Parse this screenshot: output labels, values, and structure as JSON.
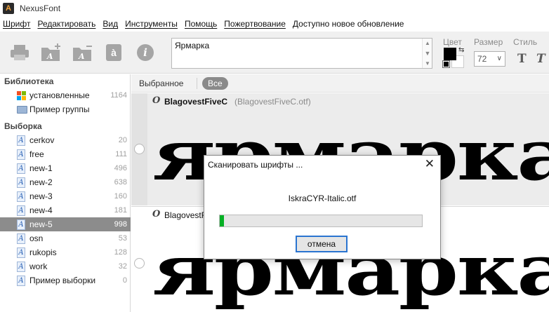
{
  "window": {
    "title": "NexusFont",
    "app_icon_letter": "A"
  },
  "menu": [
    {
      "label": "Шрифт",
      "underlined": true
    },
    {
      "label": "Редактировать",
      "underlined": true
    },
    {
      "label": "Вид",
      "underlined": true
    },
    {
      "label": "Инструменты",
      "underlined": true
    },
    {
      "label": "Помощь",
      "underlined": true
    },
    {
      "label": "Пожертвование",
      "underlined": true
    },
    {
      "label": "Доступно новое обновление",
      "underlined": false
    }
  ],
  "toolbar": {
    "sample_text": "Ярмарка",
    "color_label": "Цвет",
    "size_label": "Размер",
    "size_value": "72",
    "style_label": "Стиль",
    "style_bold_glyph": "T",
    "style_italic_glyph": "T",
    "fg_color": "#000000",
    "bg_color": "#ffffff",
    "icons": [
      "print-icon",
      "add-library-icon",
      "remove-library-icon",
      "character-map-icon",
      "info-icon"
    ]
  },
  "sidebar": {
    "library_title": "Библиотека",
    "library_items": [
      {
        "label": "установленные",
        "count": "1164",
        "icon": "windows-icon"
      },
      {
        "label": "Пример группы",
        "count": "",
        "icon": "folder-icon"
      }
    ],
    "selection_title": "Выборка",
    "selection_items": [
      {
        "label": "cerkov",
        "count": "20",
        "selected": false
      },
      {
        "label": "free",
        "count": "111",
        "selected": false
      },
      {
        "label": "new-1",
        "count": "496",
        "selected": false
      },
      {
        "label": "new-2",
        "count": "638",
        "selected": false
      },
      {
        "label": "new-3",
        "count": "160",
        "selected": false
      },
      {
        "label": "new-4",
        "count": "181",
        "selected": false
      },
      {
        "label": "new-5",
        "count": "998",
        "selected": true
      },
      {
        "label": "osn",
        "count": "53",
        "selected": false
      },
      {
        "label": "rukopis",
        "count": "128",
        "selected": false
      },
      {
        "label": "work",
        "count": "32",
        "selected": false
      },
      {
        "label": "Пример выборки",
        "count": "0",
        "selected": false
      }
    ]
  },
  "content": {
    "tabs": [
      {
        "label": "Выбранное",
        "active": false
      },
      {
        "label": "Все",
        "active": true
      }
    ],
    "fonts": [
      {
        "badge": "O",
        "name": "BlagovestFiveC",
        "file": "(BlagovestFiveC.otf)",
        "sample": "ярмарка"
      },
      {
        "badge": "O",
        "name": "BlagovestF",
        "file": "",
        "sample": "ярмарка"
      }
    ]
  },
  "dialog": {
    "title": "Сканировать шрифты ...",
    "close_glyph": "✕",
    "current_file": "IskraCYR-Italic.otf",
    "progress_percent": 2,
    "progress_color": "#06b025",
    "cancel_label": "отмена"
  }
}
